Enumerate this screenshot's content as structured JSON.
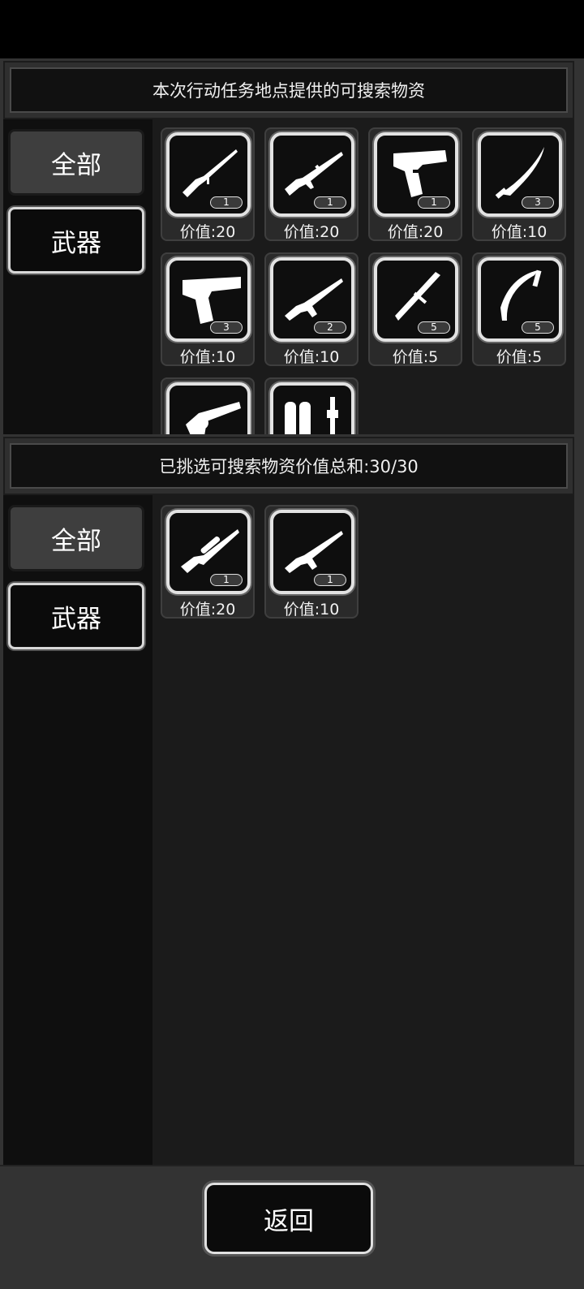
{
  "top_panel": {
    "title": "本次行动任务地点提供的可搜索物资",
    "categories": [
      {
        "label": "全部",
        "active": true
      },
      {
        "label": "武器",
        "active": false
      }
    ],
    "items": [
      {
        "icon": "rifle-icon",
        "qty": "1",
        "value": "价值:20"
      },
      {
        "icon": "assault-rifle-icon",
        "qty": "1",
        "value": "价值:20"
      },
      {
        "icon": "pistol-icon",
        "qty": "1",
        "value": "价值:20"
      },
      {
        "icon": "machete-icon",
        "qty": "3",
        "value": "价值:10"
      },
      {
        "icon": "desert-eagle-icon",
        "qty": "3",
        "value": "价值:10"
      },
      {
        "icon": "ak-rifle-icon",
        "qty": "2",
        "value": "价值:10"
      },
      {
        "icon": "baton-icon",
        "qty": "5",
        "value": "价值:5"
      },
      {
        "icon": "kama-sickle-icon",
        "qty": "5",
        "value": "价值:5"
      },
      {
        "icon": "revolver-icon",
        "qty": "",
        "value": ""
      },
      {
        "icon": "rocket-launcher-icon",
        "qty": "",
        "value": ""
      }
    ]
  },
  "bottom_panel": {
    "title": "已挑选可搜索物资价值总和:30/30",
    "categories": [
      {
        "label": "全部",
        "active": true
      },
      {
        "label": "武器",
        "active": false
      }
    ],
    "items": [
      {
        "icon": "sniper-rifle-icon",
        "qty": "1",
        "value": "价值:20"
      },
      {
        "icon": "ak-rifle-icon",
        "qty": "1",
        "value": "价值:10"
      }
    ]
  },
  "back_button": {
    "label": "返回"
  }
}
